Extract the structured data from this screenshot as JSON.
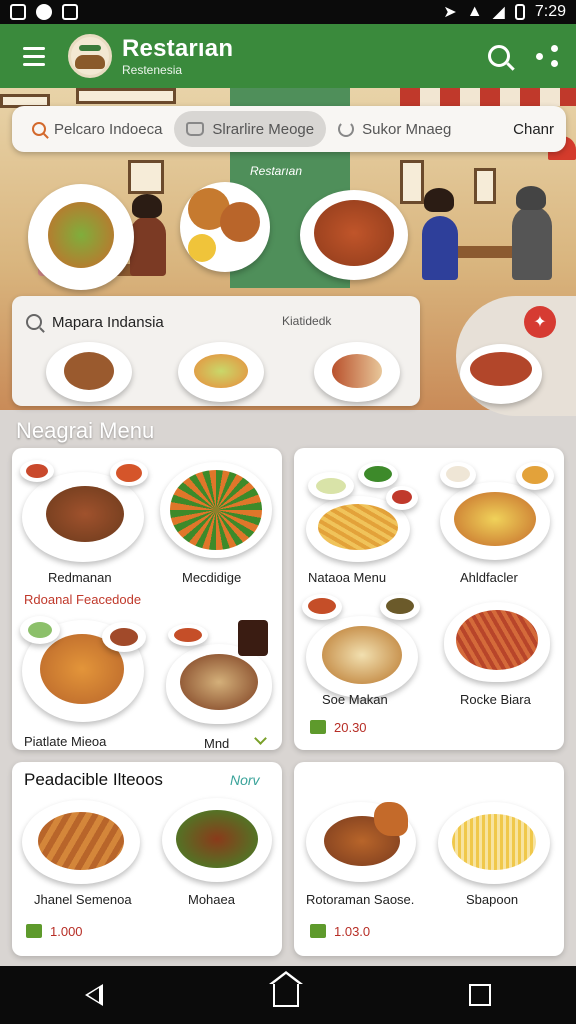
{
  "status_bar": {
    "time": "7:29",
    "left_icons": [
      "notification-icon",
      "record-icon",
      "image-icon"
    ],
    "right_icons": [
      "location-icon",
      "wifi-icon",
      "signal-icon",
      "battery-icon"
    ]
  },
  "app_bar": {
    "title": "Restarıan",
    "subtitle": "Restenesia",
    "logo_text": "Restarıan"
  },
  "search": {
    "chips": [
      {
        "label": "Pelcaro Indoeca",
        "icon": "search-icon",
        "active": false
      },
      {
        "label": "Slrarlire Meoge",
        "icon": "bag-icon",
        "active": true
      },
      {
        "label": "Sukor Mnaeg",
        "icon": "refresh-icon",
        "active": false
      }
    ],
    "trailing_label": "Chanr"
  },
  "hero": {
    "tag_text": "Restarıan"
  },
  "filter": {
    "label": "Mapara Indansia",
    "right_label": "Kiatidedk"
  },
  "section_title": "Neagrai Menu",
  "menu_cards": [
    {
      "items": [
        {
          "name": "Redmanan"
        },
        {
          "name": "Mecdidige"
        },
        {
          "name": "Piatlate Mieoa"
        },
        {
          "name": "Mnd"
        }
      ],
      "subtitle": "Rdoanal Feacedode"
    },
    {
      "items": [
        {
          "name": "Nataoa Menu"
        },
        {
          "name": "Ahldfacler"
        },
        {
          "name": "Soe Makan"
        },
        {
          "name": "Rocke Biara"
        }
      ],
      "price": "20.30"
    },
    {
      "title": "Peadacible Ilteoos",
      "badge": "Norv",
      "items": [
        {
          "name": "Jhanel Semenoa"
        },
        {
          "name": "Mohaea"
        }
      ],
      "price": "1.000"
    },
    {
      "items": [
        {
          "name": "Rotoraman Saose."
        },
        {
          "name": "Sbapoon"
        }
      ],
      "price": "1.03.0"
    }
  ],
  "colors": {
    "primary": "#3a8a3c",
    "accent_red": "#c0392b",
    "check_green": "#5e9a2c"
  },
  "nav_bar": {
    "icons": [
      "back-icon",
      "home-icon",
      "recents-icon"
    ]
  }
}
